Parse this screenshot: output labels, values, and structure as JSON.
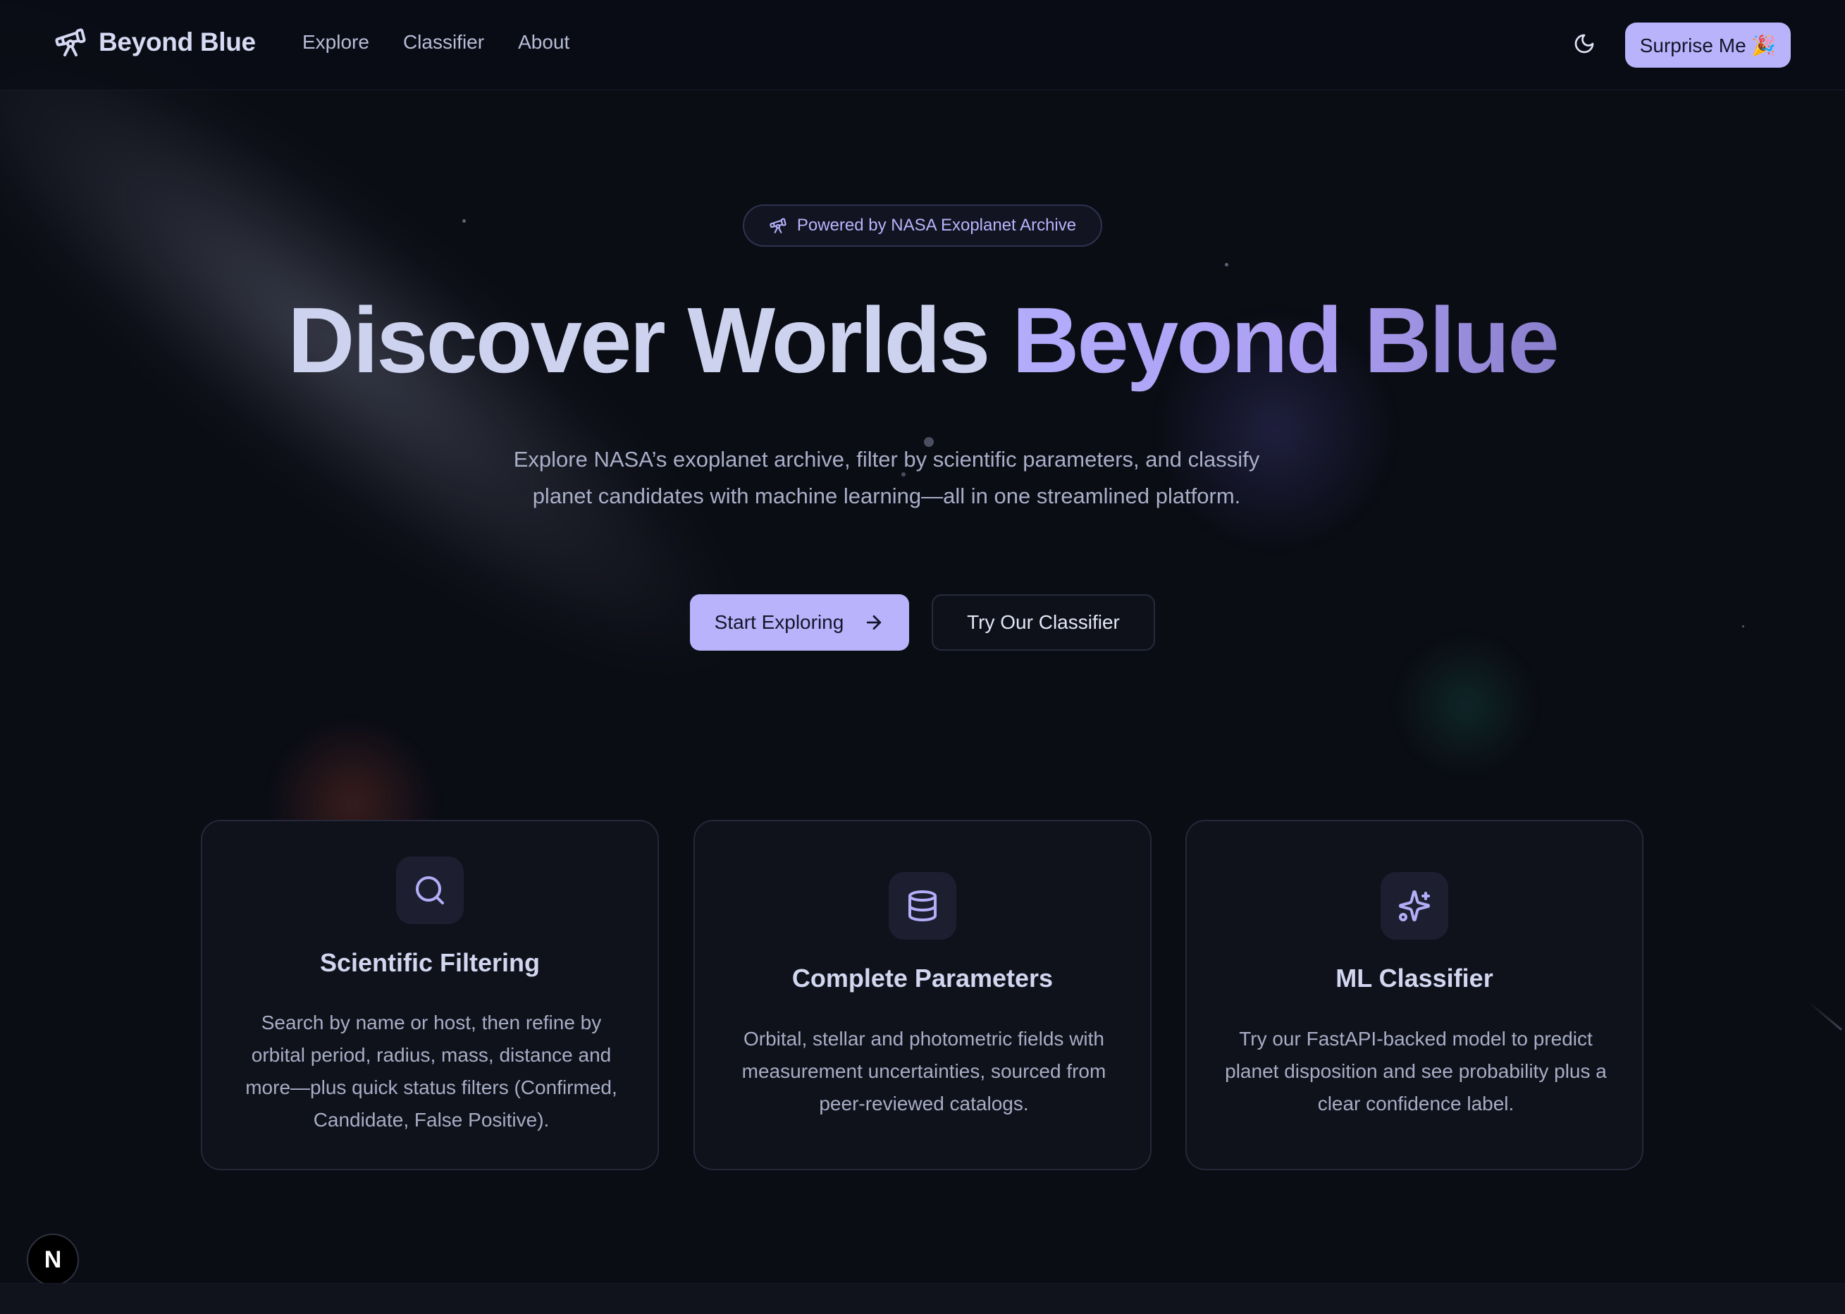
{
  "header": {
    "brand_name": "Beyond Blue",
    "brand_icon": "telescope-icon",
    "nav": [
      {
        "label": "Explore"
      },
      {
        "label": "Classifier"
      },
      {
        "label": "About"
      }
    ],
    "theme_toggle_icon": "moon-icon",
    "surprise_label": "Surprise Me 🎉"
  },
  "hero": {
    "badge_icon": "telescope-icon",
    "badge_text": "Powered by NASA Exoplanet Archive",
    "title_part1": "Discover Worlds",
    "title_part2": "Beyond Blue",
    "description_line1": "Explore NASA’s exoplanet archive, filter by scientific parameters, and classify",
    "description_line2": "planet candidates with machine learning—all in one streamlined platform.",
    "primary_button": "Start Exploring",
    "primary_button_icon": "arrow-right-icon",
    "secondary_button": "Try Our Classifier"
  },
  "features": [
    {
      "icon": "search-icon",
      "title": "Scientific Filtering",
      "description": "Search by name or host, then refine by orbital period, radius, mass, distance and more—plus quick status filters (Confirmed, Candidate, False Positive)."
    },
    {
      "icon": "database-icon",
      "title": "Complete Parameters",
      "description": "Orbital, stellar and photometric fields with measurement uncertainties, sourced from peer-reviewed catalogs."
    },
    {
      "icon": "sparkles-icon",
      "title": "ML Classifier",
      "description": "Try our FastAPI-backed model to predict planet disposition and see probability plus a clear confidence label."
    }
  ],
  "dev_badge_letter": "N",
  "colors": {
    "background": "#0b0d15",
    "accent": "#b8b3fb",
    "card_background": "#0f111b",
    "text_primary": "#d2d6ef",
    "text_secondary": "#a8adc5"
  }
}
